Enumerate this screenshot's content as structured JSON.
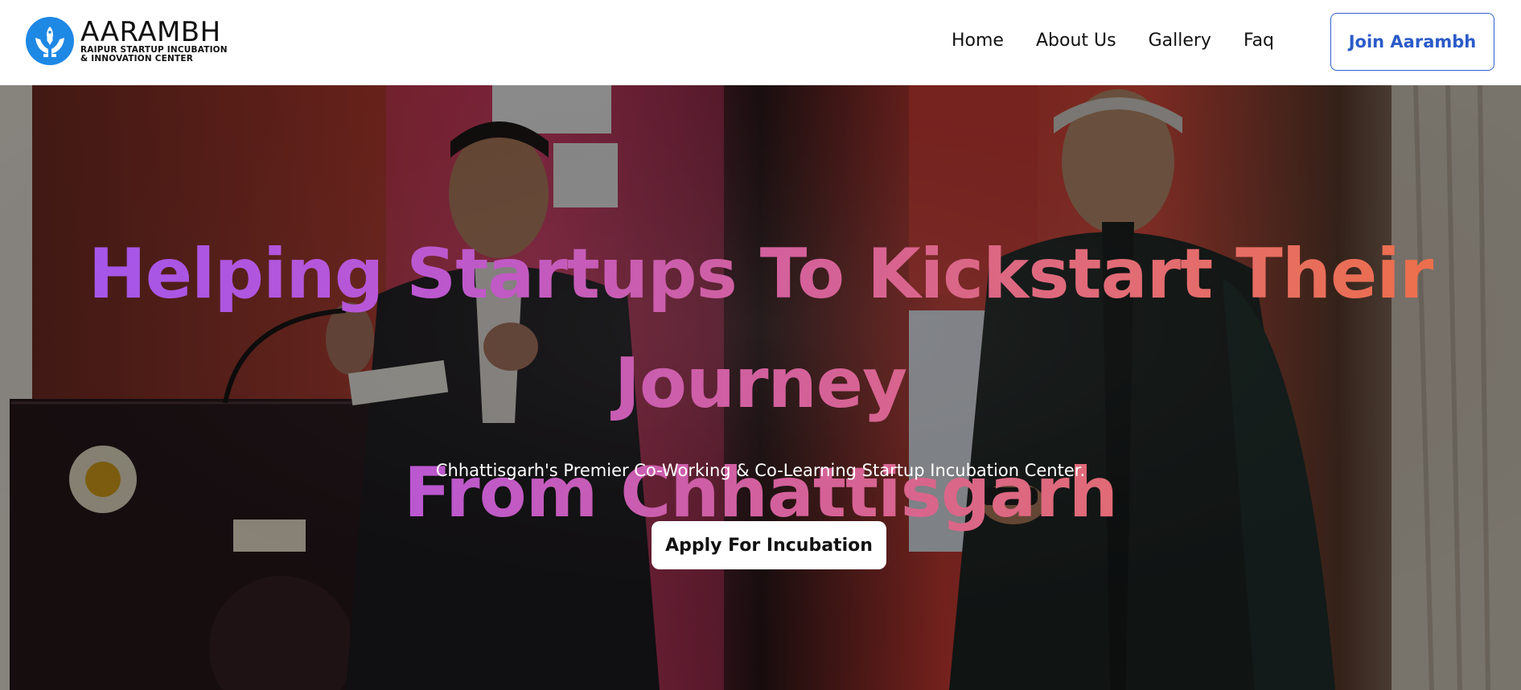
{
  "brand": {
    "name": "AARAMBH",
    "subtitle_line1": "RAIPUR STARTUP INCUBATION",
    "subtitle_line2": "& INNOVATION CENTER",
    "logo_icon": "hands-rocket-icon",
    "logo_color": "#1e88e5"
  },
  "nav": {
    "links": [
      {
        "label": "Home"
      },
      {
        "label": "About Us"
      },
      {
        "label": "Gallery"
      },
      {
        "label": "Faq"
      }
    ],
    "cta_label": "Join Aarambh",
    "cta_color": "#2b5bc9"
  },
  "hero": {
    "title_line1": "Helping Startups To Kickstart Their Journey",
    "title_line2": "From Chhattisgarh",
    "subtitle": "Chhattisgarh's Premier Co-Working & Co-Learning Startup Incubation Center.",
    "button_label": "Apply For Incubation",
    "gradient_colors": [
      "#9f55ef",
      "#d2609e",
      "#f0703f"
    ],
    "background_image": "event-stage-photo"
  }
}
